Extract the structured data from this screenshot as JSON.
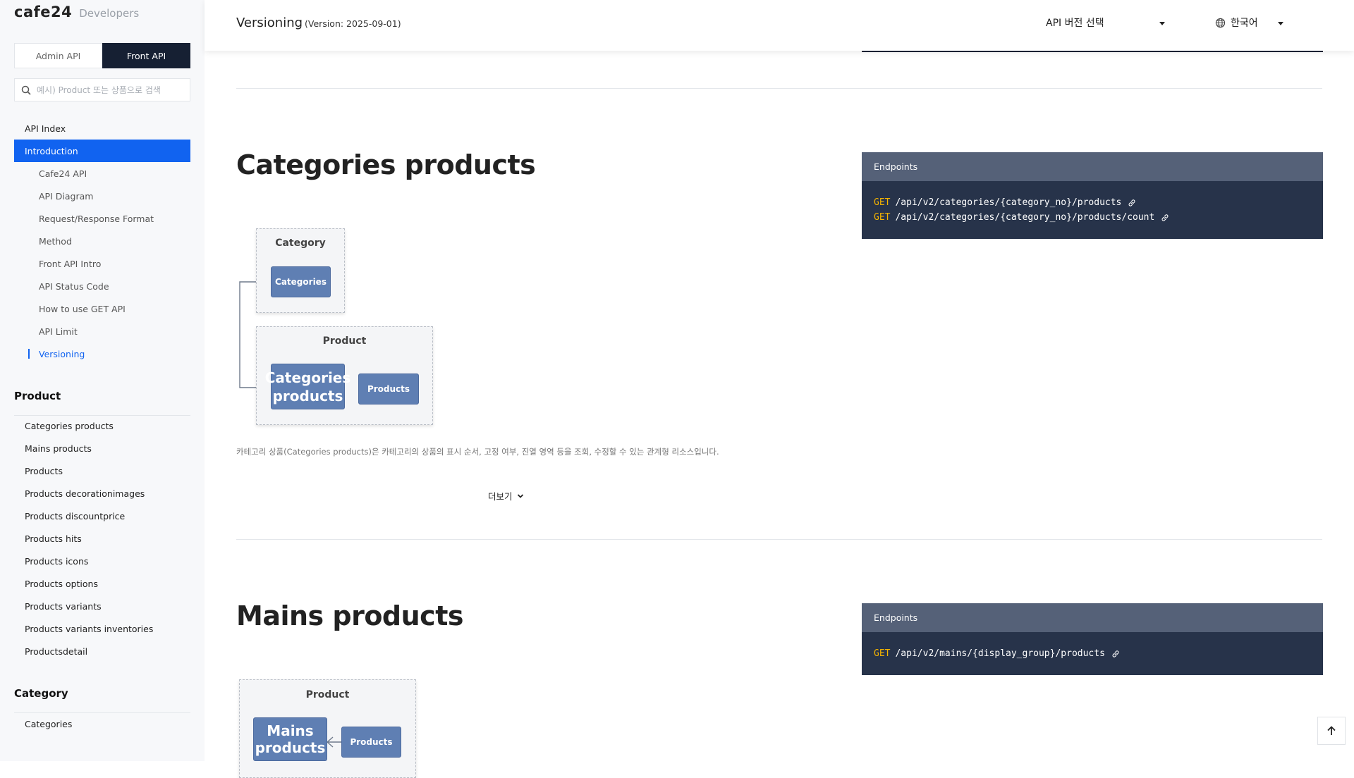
{
  "brand": {
    "logo": "cafe24",
    "sub": "Developers"
  },
  "sidebar": {
    "tabs": {
      "admin": "Admin API",
      "front": "Front API"
    },
    "search_placeholder": "예시) Product 또는 상품으로 검색",
    "top_items": [
      "API Index",
      "Introduction"
    ],
    "intro_items": [
      "Cafe24 API",
      "API Diagram",
      "Request/Response Format",
      "Method",
      "Front API Intro",
      "API Status Code",
      "How to use GET API",
      "API Limit",
      "Versioning"
    ],
    "groups": [
      {
        "title": "Product",
        "items": [
          "Categories products",
          "Mains products",
          "Products",
          "Products decorationimages",
          "Products discountprice",
          "Products hits",
          "Products icons",
          "Products options",
          "Products variants",
          "Products variants inventories",
          "Productsdetail"
        ]
      },
      {
        "title": "Category",
        "items": [
          "Categories"
        ]
      }
    ]
  },
  "header": {
    "title": "Versioning",
    "version": "(Version: 2025-09-01)",
    "version_select": "API 버전 선택",
    "language": "한국어"
  },
  "sections": [
    {
      "title": "Categories products",
      "endpoints_label": "Endpoints",
      "endpoints": [
        {
          "method": "GET",
          "path": "/api/v2/categories/{category_no}/products"
        },
        {
          "method": "GET",
          "path": "/api/v2/categories/{category_no}/products/count"
        }
      ],
      "diagram": {
        "box1": "Category",
        "node1": "Categories",
        "box2": "Product",
        "node2": "Categories products",
        "node3": "Products"
      },
      "description": "카테고리 상품(Categories products)은 카테고리의 상품의 표시 순서, 고정 여부, 진열 영역 등을 조회, 수정할 수 있는 관계형 리소스입니다.",
      "more": "더보기"
    },
    {
      "title": "Mains products",
      "endpoints_label": "Endpoints",
      "endpoints": [
        {
          "method": "GET",
          "path": "/api/v2/mains/{display_group}/products"
        }
      ],
      "diagram": {
        "box1": "Product",
        "node1": "Mains products",
        "node2": "Products"
      }
    }
  ],
  "icons": [
    "search-icon",
    "globe-icon",
    "link-icon",
    "chevron-down-icon",
    "arrow-up-icon"
  ],
  "colors": {
    "accent": "#1163f0",
    "navy": "#162033",
    "endpoint_bg": "#27334a",
    "endpoint_head": "#556178",
    "method": "#f5b400",
    "node": "#5f7fb3"
  }
}
